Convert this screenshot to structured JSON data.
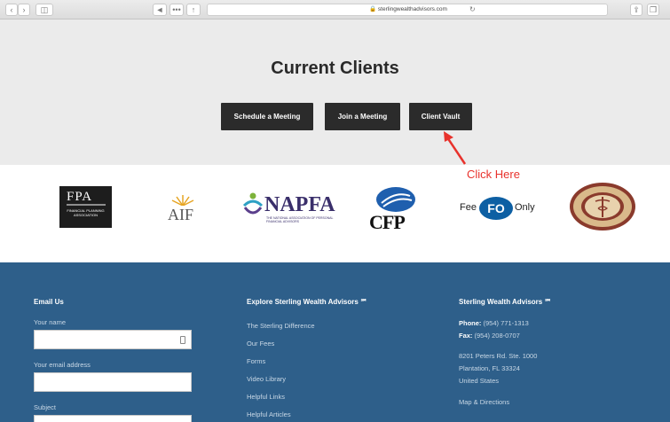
{
  "browser": {
    "url": "sterlingwealthadvisors.com"
  },
  "hero": {
    "title": "Current Clients",
    "buttons": [
      "Schedule a Meeting",
      "Join a Meeting",
      "Client Vault"
    ]
  },
  "annotation": {
    "text": "Click Here",
    "color": "#e8322c"
  },
  "logos": {
    "fpa": {
      "big": "FPA",
      "small": "FINANCIAL PLANNING ASSOCIATION"
    },
    "aif": "AIF",
    "napfa": {
      "name": "NAPFA",
      "sub": "THE NATIONAL ASSOCIATION OF PERSONAL FINANCIAL ADVISORS"
    },
    "cfp": "CFP",
    "fee_only": {
      "left": "Fee",
      "middle": "FO",
      "right": "Only"
    }
  },
  "footer": {
    "email_col": {
      "title": "Email Us",
      "name_label": "Your name",
      "email_label": "Your email address",
      "subject_label": "Subject"
    },
    "explore_col": {
      "title": "Explore Sterling Wealth Advisors ℠",
      "links": [
        "The Sterling Difference",
        "Our Fees",
        "Forms",
        "Video Library",
        "Helpful Links",
        "Helpful Articles"
      ]
    },
    "contact_col": {
      "title": "Sterling Wealth Advisors ℠",
      "phone_label": "Phone:",
      "phone": "(954) 771-1313",
      "fax_label": "Fax:",
      "fax": "(954) 208-0707",
      "address1": "8201 Peters Rd. Ste. 1000",
      "address2": "Plantation, FL 33324",
      "country": "United States",
      "map_link": "Map & Directions"
    },
    "bg_color": "#2e5f8a"
  }
}
